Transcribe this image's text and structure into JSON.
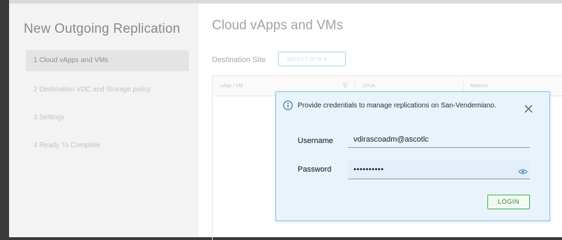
{
  "wizard": {
    "title": "New Outgoing Replication",
    "steps": [
      {
        "label": "1  Cloud vApps and VMs"
      },
      {
        "label": "2  Destination VDC and Storage policy"
      },
      {
        "label": "3  Settings"
      },
      {
        "label": "4  Ready To Complete"
      }
    ]
  },
  "main": {
    "title": "Cloud vApps and VMs",
    "destination_label": "Destination Site",
    "select_site_label": "SELECT SITE ▾",
    "columns": [
      "vApp / VM",
      "CPUs",
      "Memory"
    ]
  },
  "credentials_popup": {
    "message_prefix": "Provide credentials to manage replications on ",
    "site_name": "San-Vendemiano",
    "message_suffix": ".",
    "username_label": "Username",
    "username_value": "vdirascoadm@ascotlc",
    "password_label": "Password",
    "password_value": "••••••••••",
    "login_label": "LOGIN"
  },
  "colors": {
    "accent": "#82c6e8",
    "login_green": "#4ca84c",
    "popup_bg": "#e8f3fb"
  },
  "icons": {
    "info": "info-icon",
    "close": "close-icon",
    "show_password": "eye-icon",
    "filter": "filter-icon"
  }
}
